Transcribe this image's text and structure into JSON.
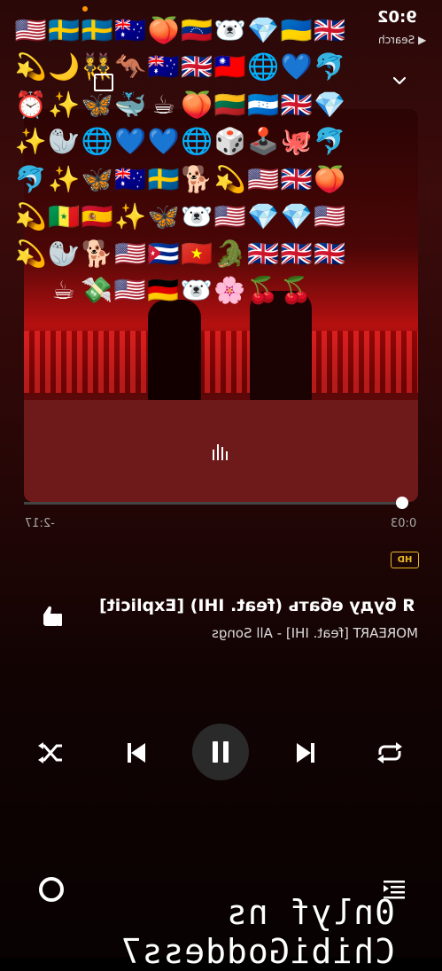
{
  "status": {
    "time": "9:02",
    "back_label": "Search"
  },
  "track": {
    "title": "Я буду ебать (feat. IHI) [Explicit]",
    "subtitle": "MOREART [feat. IHI] - All Songs",
    "quality_badge": "HD",
    "elapsed": "0:03",
    "remaining": "-2:17",
    "progress": 0.02
  },
  "watermark": "0nlyf ns ChibiGoddess7",
  "emoji": {
    "row1": [
      "🇺🇸",
      "🇸🇪",
      "🇸🇪",
      "🇦🇺",
      "🍑",
      "🇻🇪",
      "🐻‍❄️",
      "💎",
      "🇺🇦",
      "🇬🇧"
    ],
    "row2": [
      "💫",
      "🌙",
      "👯",
      "🦘",
      "🇦🇺",
      "🇬🇧",
      "🇹🇼",
      "🌐",
      "💙",
      "🐬"
    ],
    "row3": [
      "⏰",
      "✨",
      "🦋",
      "🐳",
      "☕",
      "🍑",
      "🇱🇹",
      "🇭🇳",
      "🇬🇧",
      "💎"
    ],
    "row4": [
      "✨",
      "🦭",
      "🌐",
      "💙",
      "💙",
      "🌐",
      "🎲",
      "🕹️",
      "🐙",
      "🐬"
    ],
    "row5": [
      "🐬",
      "✨",
      "🦋",
      "🇦🇺",
      "🇸🇪",
      "🐕",
      "💫",
      "🇺🇸",
      "🇬🇧",
      "🍑"
    ],
    "row6": [
      "💫",
      "🇸🇳",
      "🇪🇸",
      "✨",
      "🦋",
      "🐻‍❄️",
      "🇺🇸",
      "💎",
      "💎",
      "🇺🇸"
    ],
    "row7": [
      "💫",
      "🦭",
      "🐕",
      "🇺🇸",
      "🇨🇺",
      "🇻🇳",
      "🐊",
      "🇬🇧",
      "🇬🇧",
      "🇬🇧"
    ],
    "row8": [
      "☕",
      "💸",
      "🇺🇸",
      "🇩🇪",
      "🐻‍❄️",
      "🌸",
      "🍒",
      "🍒"
    ]
  },
  "colors": {
    "accent_hd": "#e8b923",
    "art_red": "#b51010"
  }
}
